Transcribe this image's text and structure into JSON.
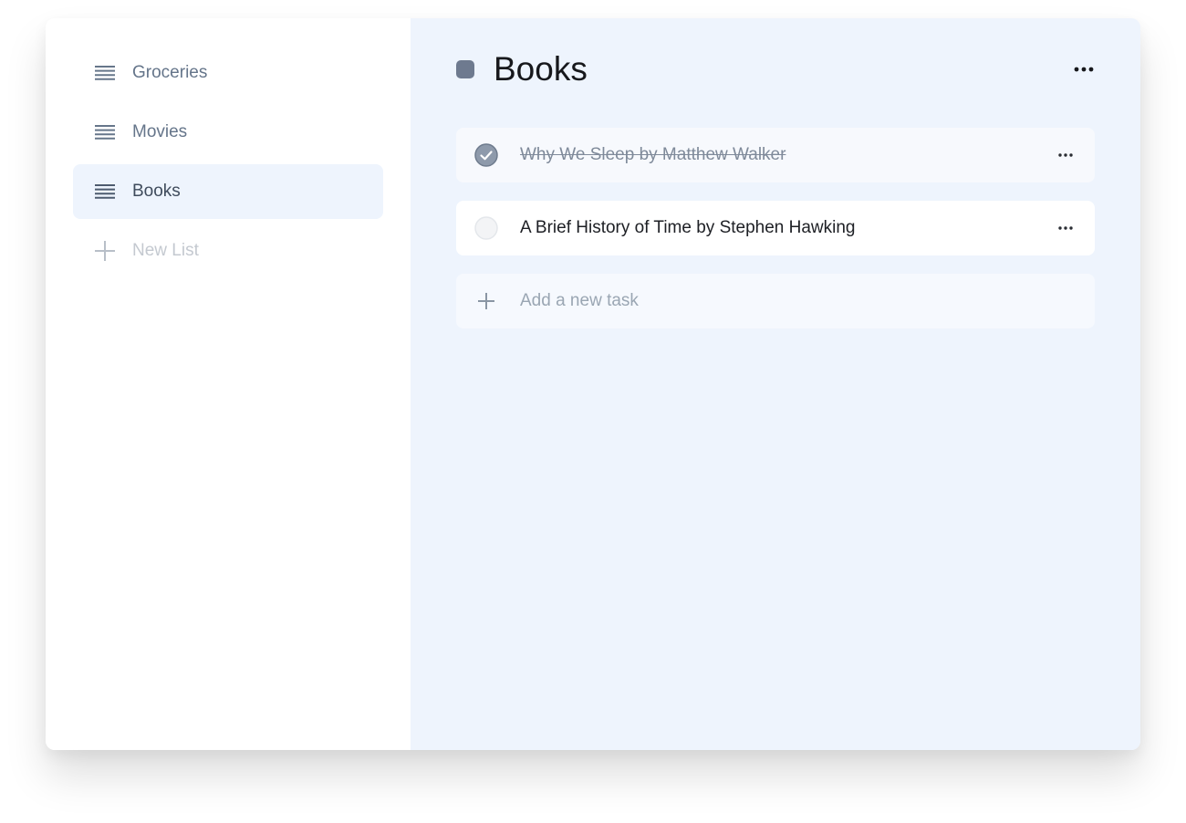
{
  "sidebar": {
    "items": [
      {
        "label": "Groceries",
        "icon": "list-icon",
        "active": false
      },
      {
        "label": "Movies",
        "icon": "list-icon",
        "active": false
      },
      {
        "label": "Books",
        "icon": "list-icon",
        "active": true
      }
    ],
    "new_list": {
      "label": "New List",
      "icon": "plus-icon"
    }
  },
  "main": {
    "title": "Books",
    "color": "#6e7a8f",
    "menu_icon": "more-horizontal-icon",
    "tasks": [
      {
        "text": "Why We Sleep by Matthew Walker",
        "completed": true
      },
      {
        "text": "A Brief History of Time by Stephen Hawking",
        "completed": false
      }
    ],
    "add_task": {
      "placeholder": "Add a new task",
      "icon": "plus-icon"
    }
  },
  "colors": {
    "accent_bg": "#eef4fd",
    "text_muted": "#65758a",
    "text_dark": "#17181c"
  }
}
